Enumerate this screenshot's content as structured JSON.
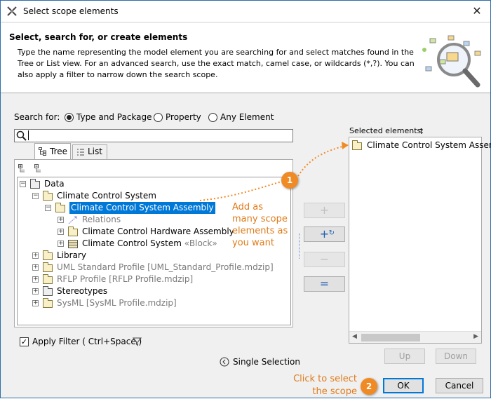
{
  "window": {
    "title": "Select scope elements",
    "close_glyph": "✕"
  },
  "header": {
    "heading": "Select, search for, or create elements",
    "description": "Type the name representing the model element you are searching for and select matches found in the Tree or List view. For an advanced search, use the exact match, camel case, or wildcards (*,?). You can also apply a filter to narrow down the search scope."
  },
  "search": {
    "label": "Search for:",
    "options": [
      "Type and Package",
      "Property",
      "Any Element"
    ],
    "selected": "Type and Package",
    "value": ""
  },
  "tabs": [
    "Tree",
    "List"
  ],
  "tree": [
    {
      "label": "Data"
    },
    {
      "label": "Climate Control System"
    },
    {
      "label": "Climate Control System Assembly",
      "selected": true
    },
    {
      "label": "Relations"
    },
    {
      "label": "Climate Control Hardware Assembly"
    },
    {
      "label": "Climate Control System",
      "suffix": "«Block»"
    },
    {
      "label": "Library"
    },
    {
      "label": "UML Standard Profile [UML_Standard_Profile.mdzip]"
    },
    {
      "label": "RFLP Profile [RFLP Profile.mdzip]"
    },
    {
      "label": "Stereotypes"
    },
    {
      "label": "SysML [SysML Profile.mdzip]"
    }
  ],
  "callout1": {
    "number": "1",
    "text_lines": [
      "Add as",
      "many scope",
      "elements as",
      "you want"
    ]
  },
  "callout2": {
    "number": "2",
    "text_lines": [
      "Click to select",
      "the scope"
    ]
  },
  "side_buttons": [
    "+",
    "+",
    "−",
    "="
  ],
  "selected_elements": {
    "label": "Selected elements:",
    "items": [
      "Climate Control System Assembly"
    ]
  },
  "filter": {
    "label": "Apply Filter ( Ctrl+Space )",
    "checked": true
  },
  "single_selection": "Single Selection",
  "buttons": {
    "up": "Up",
    "down": "Down",
    "ok": "OK",
    "cancel": "Cancel"
  },
  "colors": {
    "accent": "#0078d7",
    "callout": "#f08a24"
  }
}
